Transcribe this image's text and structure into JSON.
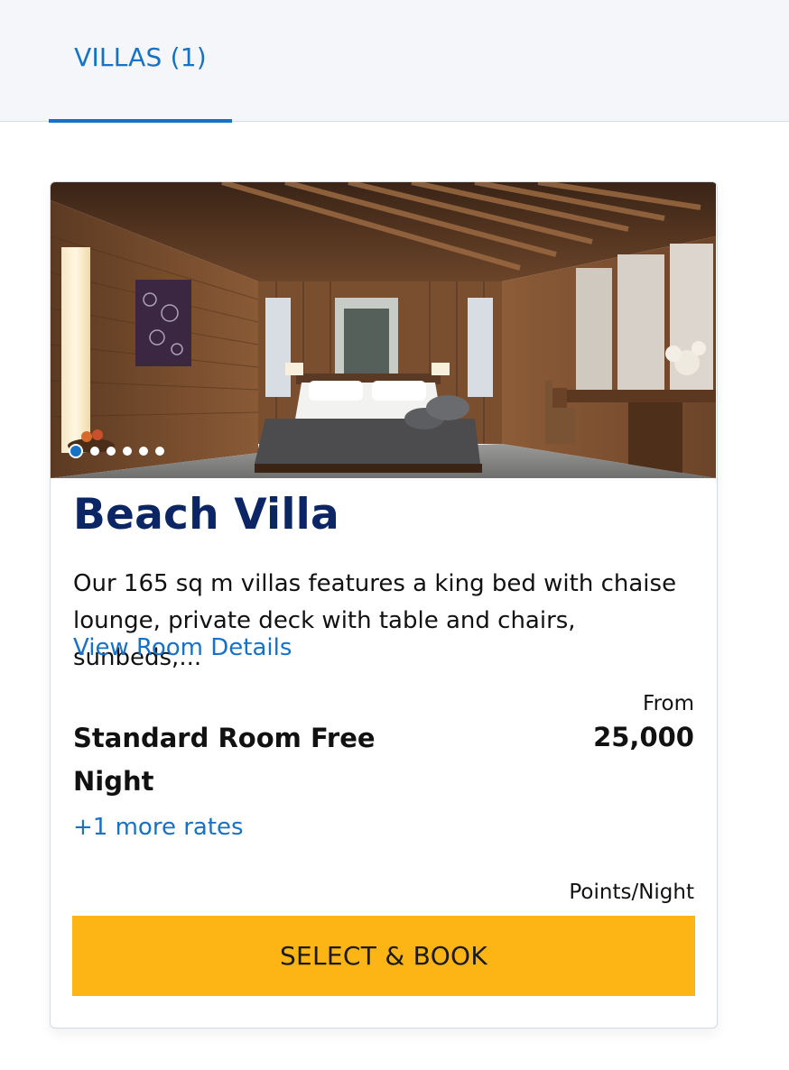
{
  "tabs": [
    {
      "label": "VILLAS (1)",
      "active": true
    }
  ],
  "room": {
    "image_alt": "Beach Villa bedroom",
    "carousel": {
      "total": 6,
      "current": 1
    },
    "title": "Beach Villa",
    "description": "Our 165 sq m villas features a king bed with chaise lounge, private deck with table and chairs, sunbeds,...",
    "details_link": "View Room Details",
    "rate": {
      "from_label": "From",
      "name": "Standard Room Free Night",
      "points": "25,000",
      "unit": "Points/Night",
      "more_rates": "+1 more rates"
    },
    "book_button": "SELECT & BOOK"
  },
  "colors": {
    "accent": "#1672c6",
    "title": "#0b2565",
    "button": "#fdb515",
    "tabbar_bg": "#f4f6f9"
  }
}
